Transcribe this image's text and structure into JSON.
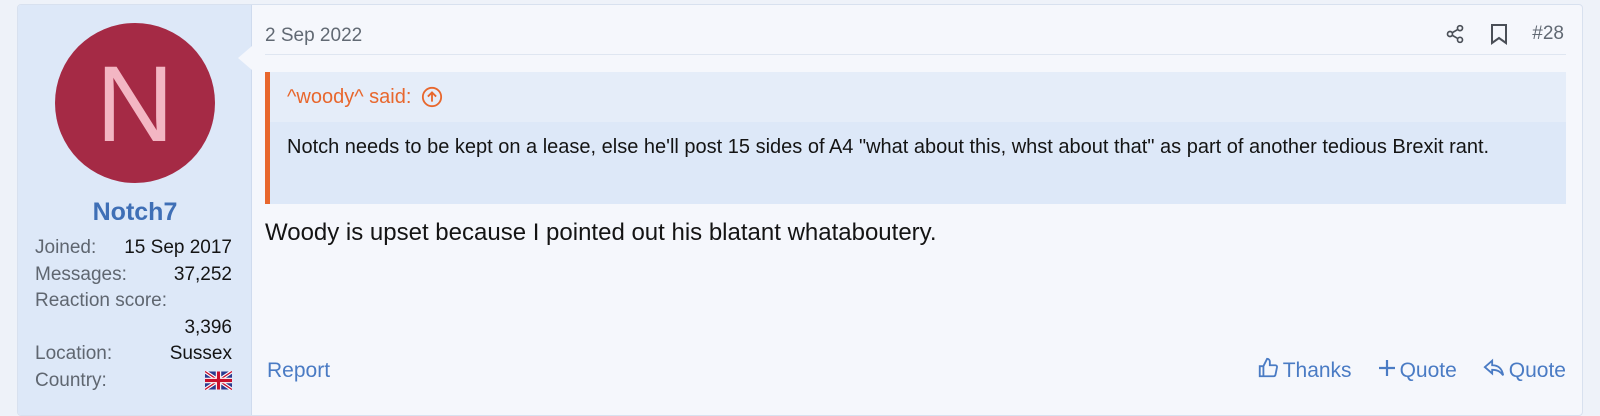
{
  "user": {
    "avatar_letter": "N",
    "avatar_color": "#a52a45",
    "username": "Notch7",
    "joined_label": "Joined:",
    "joined_value": "15 Sep 2017",
    "messages_label": "Messages:",
    "messages_value": "37,252",
    "reaction_label": "Reaction score:",
    "reaction_value": "3,396",
    "location_label": "Location:",
    "location_value": "Sussex",
    "country_label": "Country:",
    "country_flag_icon": "uk-flag-icon"
  },
  "post": {
    "date": "2 Sep 2022",
    "number": "#28",
    "share_icon": "share-icon",
    "bookmark_icon": "bookmark-icon",
    "quote": {
      "attribution": "^woody^ said:",
      "jump_icon": "arrow-up-circle-icon",
      "text": "Notch needs to be kept on a lease, else he'll post 15 sides of A4 \"what about this, whst about that\" as part of another tedious Brexit rant."
    },
    "message": "Woody is upset because I pointed out his blatant whataboutery."
  },
  "footer": {
    "report": "Report",
    "thanks": "Thanks",
    "multiquote": "Quote",
    "reply_quote": "Quote"
  },
  "colors": {
    "accent": "#3f6fb6",
    "quote_accent": "#e8672d",
    "sidebar_bg": "#dde8f8"
  }
}
